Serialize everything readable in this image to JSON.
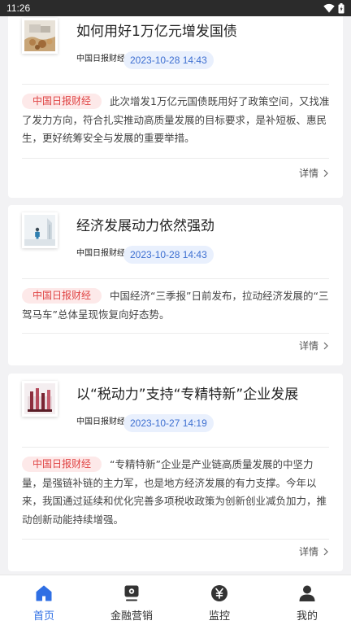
{
  "status_bar": {
    "time": "11:26"
  },
  "articles": [
    {
      "title": "如何用好1万亿元增发国债",
      "source": "中国日报财经",
      "datetime": "2023-10-28 14:43",
      "tag": "中国日报财经",
      "summary": "此次增发1万亿元国债既用好了政策空间，又找准了发力方向，符合扎实推动高质量发展的目标要求，是补短板、惠民生，更好统筹安全与发展的重要举措。",
      "detail_label": "详情"
    },
    {
      "title": "经济发展动力依然强劲",
      "source": "中国日报财经",
      "datetime": "2023-10-28 14:43",
      "tag": "中国日报财经",
      "summary": "中国经济“三季报”日前发布，拉动经济发展的“三驾马车”总体呈现恢复向好态势。",
      "detail_label": "详情"
    },
    {
      "title": "以“税动力”支持“专精特新”企业发展",
      "source": "中国日报财经",
      "datetime": "2023-10-27 14:19",
      "tag": "中国日报财经",
      "summary": "“专精特新”企业是产业链高质量发展的中坚力量，是强链补链的主力军，也是地方经济发展的有力支撑。今年以来，我国通过延续和优化完善多项税收政策为创新创业减负加力，推动创新动能持续增强。",
      "detail_label": "详情"
    }
  ],
  "tabbar": {
    "active_color": "#2f6fe4",
    "items": [
      {
        "label": "首页",
        "icon": "home-icon",
        "active": true
      },
      {
        "label": "金融营销",
        "icon": "marketing-icon",
        "active": false
      },
      {
        "label": "监控",
        "icon": "yuan-icon",
        "active": false
      },
      {
        "label": "我的",
        "icon": "user-icon",
        "active": false
      }
    ]
  }
}
